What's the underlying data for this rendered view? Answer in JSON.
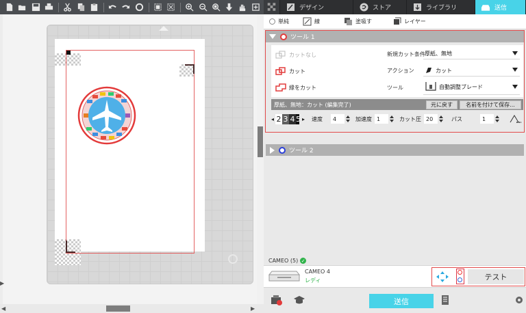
{
  "toolbar": {
    "icons": [
      "new-file-icon",
      "open-folder-icon",
      "save-icon",
      "print-icon",
      "cut-icon",
      "copy-icon",
      "paste-icon",
      "undo-icon",
      "redo-icon",
      "refresh-icon",
      "select-icon",
      "deselect-icon",
      "zoom-in-icon",
      "zoom-out-icon",
      "zoom-box-icon",
      "move-down-icon",
      "pan-hand-icon",
      "add-page-icon"
    ]
  },
  "topnav": {
    "tabs": [
      {
        "label": "デザイン",
        "icon": "design-icon"
      },
      {
        "label": "ストア",
        "icon": "store-icon"
      },
      {
        "label": "ライブラリ",
        "icon": "library-icon"
      },
      {
        "label": "送信",
        "icon": "send-machine-icon",
        "active": true
      }
    ]
  },
  "mode": {
    "items": [
      {
        "label": "単純",
        "icon": "radio-icon"
      },
      {
        "label": "線",
        "icon": "line-icon"
      },
      {
        "label": "塗吸す",
        "icon": "fill-icon"
      },
      {
        "label": "レイヤー",
        "icon": "layer-icon"
      }
    ]
  },
  "tool1": {
    "title": "ツール 1",
    "ring_color": "#e23b3b",
    "actions": [
      {
        "label": "カットなし",
        "enabled": false
      },
      {
        "label": "カット",
        "enabled": true
      },
      {
        "label": "縁をカット",
        "enabled": true
      }
    ],
    "fields": [
      {
        "label": "新規カット条件",
        "value": "厚紙、無地"
      },
      {
        "label": "アクション",
        "value": "カット"
      },
      {
        "label": "ツール",
        "value": "自動調整ブレード"
      }
    ],
    "status": "厚紙、無地：カット (編集完了)",
    "revert_label": "元に戻す",
    "save_as_label": "名前を付けて保存...",
    "depth_digits": [
      "2",
      "3",
      "4",
      "5"
    ],
    "params": [
      {
        "label": "速度",
        "value": "4"
      },
      {
        "label": "加速度",
        "value": "1"
      },
      {
        "label": "カット圧",
        "value": "20"
      },
      {
        "label": "パス",
        "value": "1"
      }
    ]
  },
  "tool2": {
    "title": "ツール 2",
    "ring_color": "#2b3fd9"
  },
  "device": {
    "header": "CAMEO (5)",
    "name": "CAMEO 4",
    "status": "レディ"
  },
  "test_label": "テスト",
  "send_label": "送信",
  "colors": {
    "accent": "#48d3e8",
    "highlight_border": "#e24a4a",
    "ready_green": "#2fb34a"
  }
}
